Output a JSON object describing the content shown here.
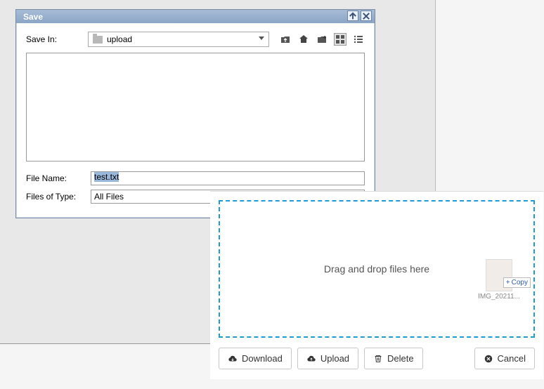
{
  "dialog": {
    "title": "Save",
    "saveInLabel": "Save In:",
    "location": "upload",
    "fileNameLabel": "File Name:",
    "fileName": "test.txt",
    "filesOfTypeLabel": "Files of Type:",
    "filesOfType": "All Files"
  },
  "upload": {
    "dropText": "Drag and drop files here",
    "file": {
      "name": "IMG_20211...",
      "copy": "Copy"
    },
    "buttons": {
      "download": "Download",
      "upload": "Upload",
      "delete": "Delete",
      "cancel": "Cancel"
    }
  }
}
